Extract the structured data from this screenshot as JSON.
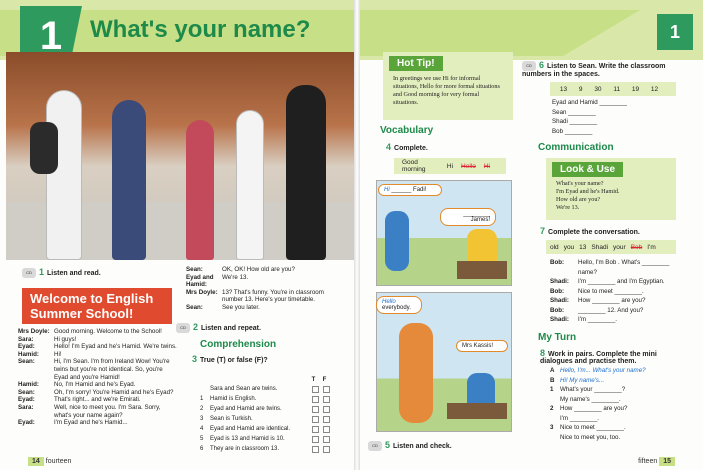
{
  "header": {
    "unit_number": "1",
    "title": "What's your name?",
    "unit_number_right": "1"
  },
  "left": {
    "ex1": {
      "cd": "CD1\n11",
      "num": "1",
      "instr": "Listen and read."
    },
    "welcome": "Welcome to English Summer School!",
    "dialog_a": [
      {
        "sp": "Mrs Doyle:",
        "tx": "Good morning. Welcome to the School!"
      },
      {
        "sp": "Sara:",
        "tx": "Hi guys!"
      },
      {
        "sp": "Eyad:",
        "tx": "Hello! I'm Eyad and he's Hamid. We're twins."
      },
      {
        "sp": "Hamid:",
        "tx": "Hi!"
      },
      {
        "sp": "Sean:",
        "tx": "Hi, I'm Sean. I'm from Ireland Wow! You're twins but you're not identical. So, you're Eyad and you're Hamid!"
      },
      {
        "sp": "Hamid:",
        "tx": "No, I'm Hamid and he's Eyad."
      },
      {
        "sp": "Sean:",
        "tx": "Oh, I'm sorry! You're Hamid and he's Eyad?"
      },
      {
        "sp": "Eyad:",
        "tx": "That's right... and we're Emirati."
      },
      {
        "sp": "Sara:",
        "tx": "Well, nice to meet you. I'm Sara. Sorry, what's your name again?"
      },
      {
        "sp": "Eyad:",
        "tx": "I'm Eyad and he's Hamid..."
      }
    ],
    "dialog_b": [
      {
        "sp": "Sean:",
        "tx": "OK, OK! How old are you?"
      },
      {
        "sp": "Eyad and Hamid:",
        "tx": "We're 13."
      },
      {
        "sp": "Mrs Doyle:",
        "tx": "13? That's funny. You're in classroom number 13. Here's your timetable."
      },
      {
        "sp": "Sean:",
        "tx": "See you later."
      }
    ],
    "ex2": {
      "cd": "CD1\n12",
      "num": "2",
      "instr": "Listen and repeat."
    },
    "comprehension": "Comprehension",
    "ex3": {
      "num": "3",
      "instr": "True (T) or false (F)?"
    },
    "tf_header": {
      "t": "T",
      "f": "F"
    },
    "tf_items": [
      {
        "n": "",
        "s": "Sara and Sean are twins."
      },
      {
        "n": "1",
        "s": "Hamid is English."
      },
      {
        "n": "2",
        "s": "Eyad and Hamid are twins."
      },
      {
        "n": "3",
        "s": "Sean is Turkish."
      },
      {
        "n": "4",
        "s": "Eyad and Hamid are identical."
      },
      {
        "n": "5",
        "s": "Eyad is 13 and Hamid is 10."
      },
      {
        "n": "6",
        "s": "They are in classroom 13."
      }
    ],
    "page_num": "14",
    "page_word": "fourteen"
  },
  "right": {
    "hottip": {
      "heading": "Hot Tip!",
      "text": "In greetings we use Hi for informal situations, Hello for more formal situations and Good morning for very formal situations."
    },
    "vocabulary": "Vocabulary",
    "ex4": {
      "num": "4",
      "instr": "Complete."
    },
    "wordbank4": [
      "Good morning",
      "Hi",
      "Hello",
      "Hi"
    ],
    "bubbles": {
      "hi": "Hi",
      "fadi": "Fadi!",
      "james": "James!",
      "hello": "Hello",
      "everybody": "everybody.",
      "kassis": "Mrs Kassis!"
    },
    "ex5": {
      "cd": "CD1\n13",
      "num": "5",
      "instr": "Listen and check."
    },
    "ex6": {
      "cd": "CD1\n14",
      "num": "6",
      "instr": "Listen to Sean. Write the classroom numbers in the spaces."
    },
    "numbers6": [
      "13",
      "9",
      "30",
      "11",
      "19",
      "12"
    ],
    "names6": [
      "Eyad and Hamid ________",
      "Sean ________",
      "Shadi ________",
      "Bob ________"
    ],
    "communication": "Communication",
    "lookuse": {
      "heading": "Look & Use",
      "lines": [
        "What's your name?",
        "I'm Eyad and he's Hamid.",
        "How old are you?",
        "We're 13."
      ]
    },
    "ex7": {
      "num": "7",
      "instr": "Complete the conversation."
    },
    "wordbank7": [
      "old",
      "you",
      "13",
      "Shadi",
      "your",
      "Bob",
      "I'm"
    ],
    "conv7": [
      {
        "sp": "Bob:",
        "tx": "Hello, I'm Bob . What's ________ name?"
      },
      {
        "sp": "Shadi:",
        "tx": "I'm ________ and I'm Egyptian."
      },
      {
        "sp": "Bob:",
        "tx": "Nice to meet ________."
      },
      {
        "sp": "Shadi:",
        "tx": "How ________ are you?"
      },
      {
        "sp": "Bob:",
        "tx": "________ 12. And you?"
      },
      {
        "sp": "Shadi:",
        "tx": "I'm ________."
      }
    ],
    "myturn": "My Turn",
    "ex8": {
      "num": "8",
      "instr": "Work in pairs. Complete the mini dialogues and practise them."
    },
    "mini8": [
      {
        "n": "A",
        "tx": "Hello, I'm... What's your name?",
        "blue": true
      },
      {
        "n": "B",
        "tx": "Hi! My name's...",
        "blue": true
      },
      {
        "n": "1",
        "tx": "What's your ________?",
        "blue": false
      },
      {
        "n": "",
        "tx": "My name's ________.",
        "blue": false
      },
      {
        "n": "2",
        "tx": "How ________ are you?",
        "blue": false
      },
      {
        "n": "",
        "tx": "I'm ________.",
        "blue": false
      },
      {
        "n": "3",
        "tx": "Nice to meet ________.",
        "blue": false
      },
      {
        "n": "",
        "tx": "Nice to meet you, too.",
        "blue": false
      }
    ],
    "page_word": "fifteen",
    "page_num": "15"
  }
}
